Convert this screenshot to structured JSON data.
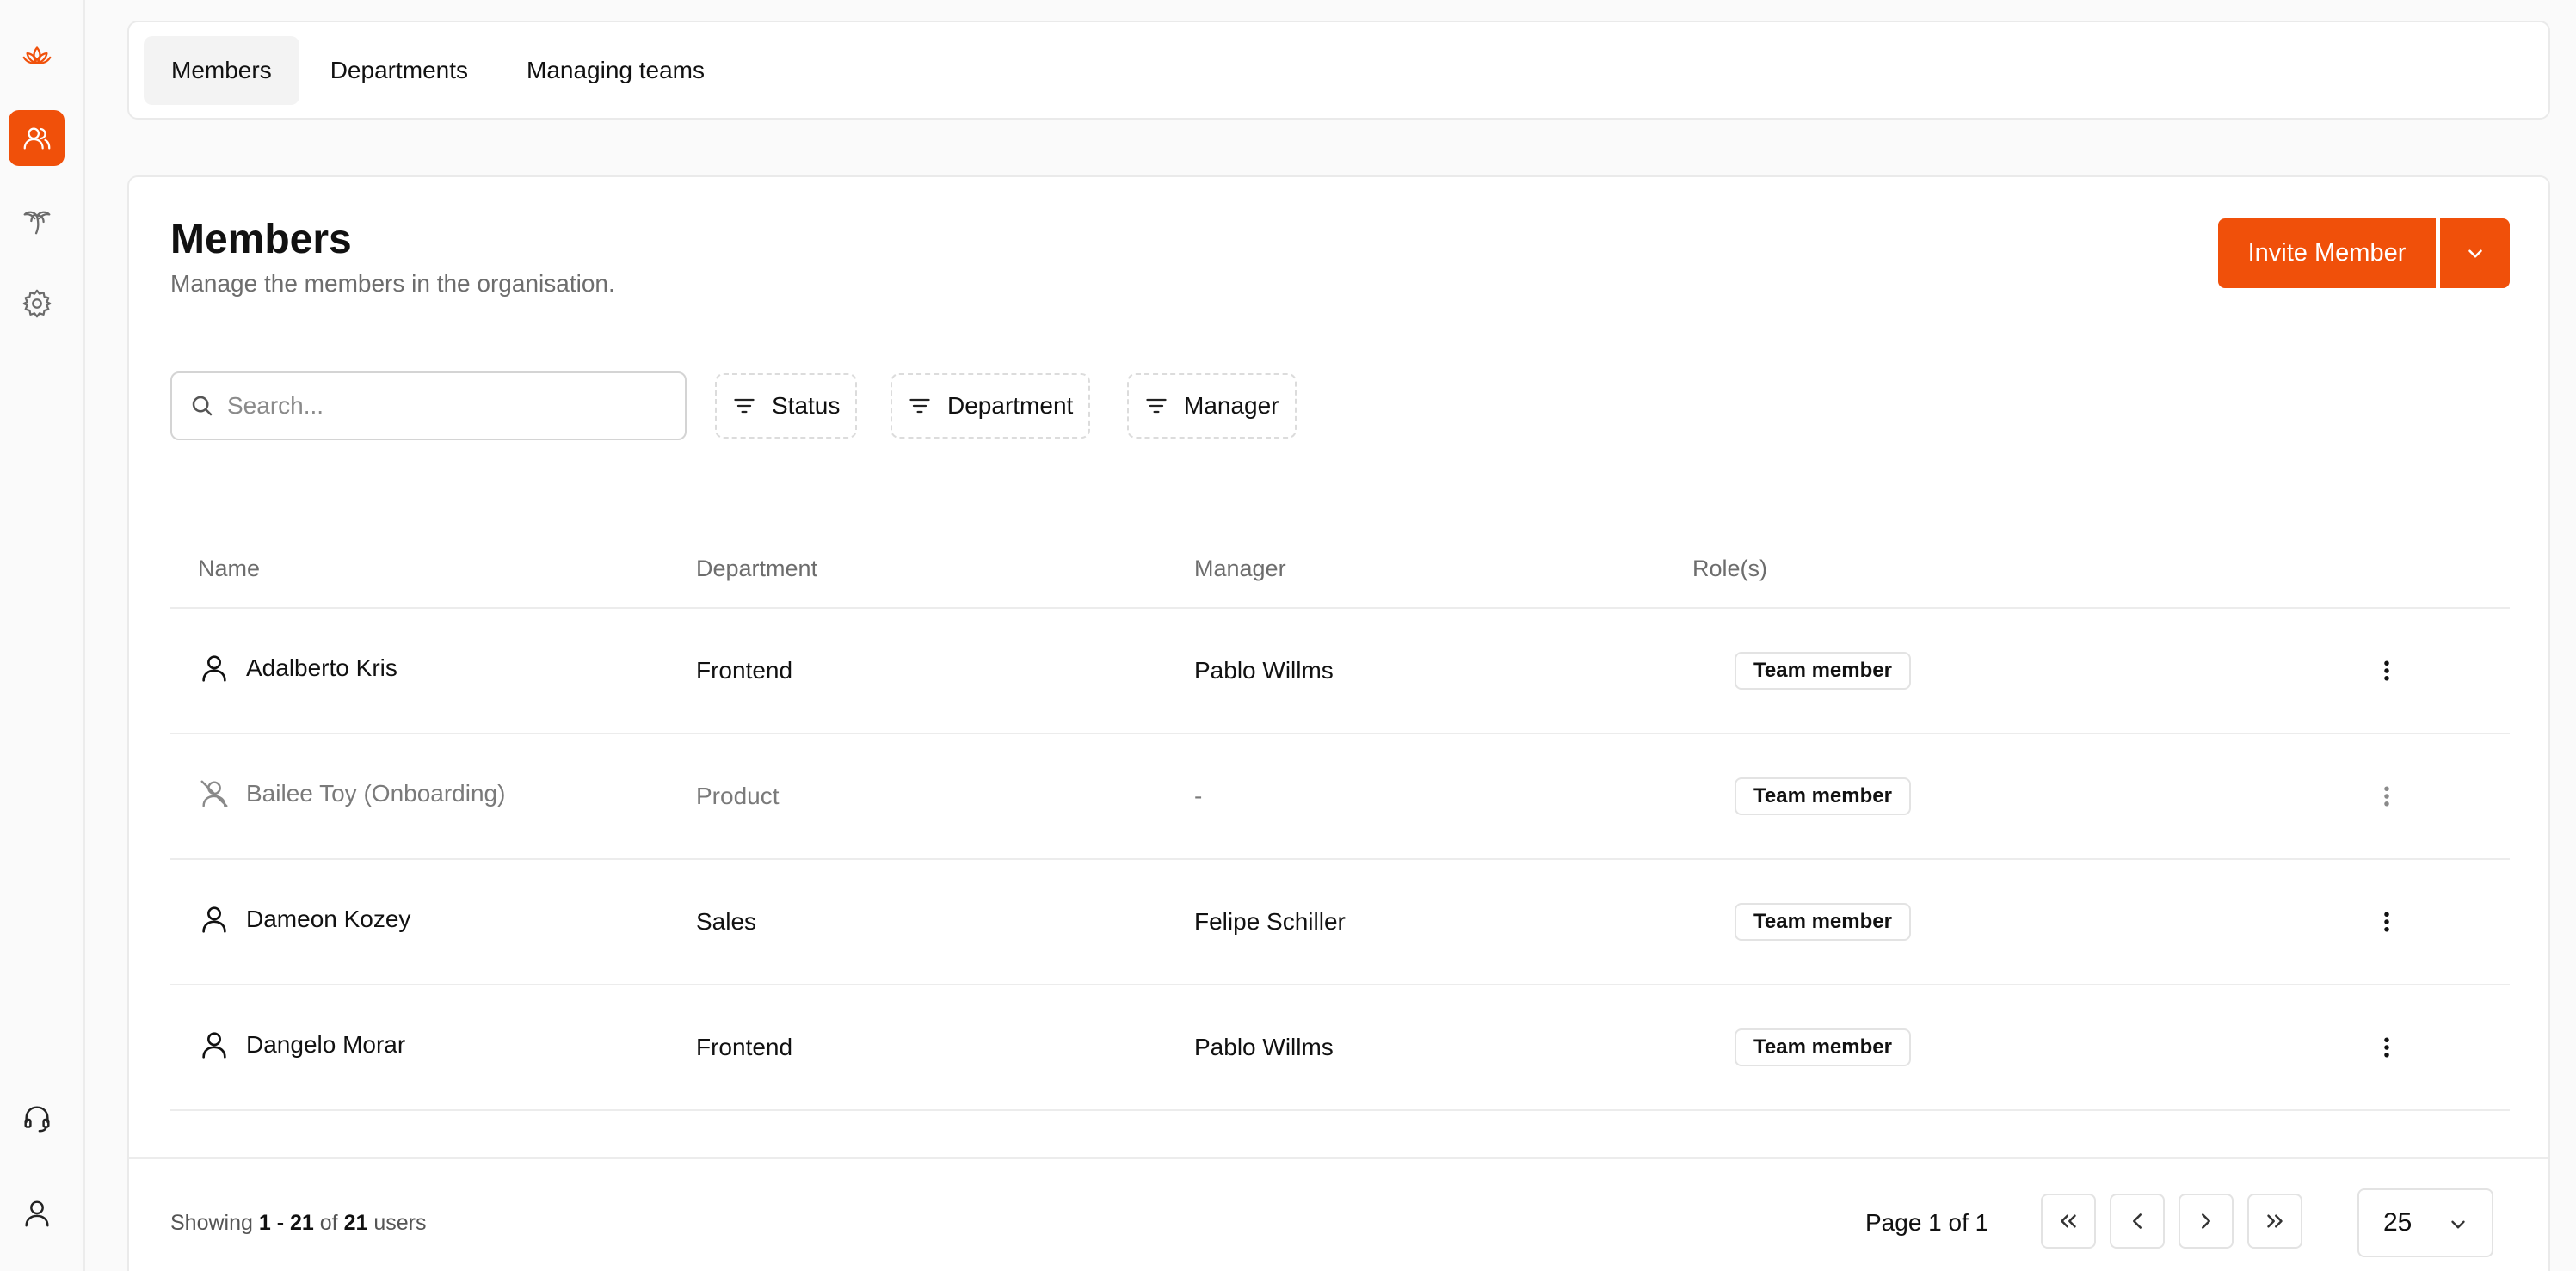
{
  "colors": {
    "accent": "#f0500a",
    "muted_text": "#6d6d6d"
  },
  "sidebar": {
    "items": [
      {
        "name": "lotus-logo-icon"
      },
      {
        "name": "members-icon",
        "active": true
      },
      {
        "name": "palm-tree-icon"
      },
      {
        "name": "settings-gear-icon"
      },
      {
        "name": "headset-support-icon"
      },
      {
        "name": "profile-user-icon"
      }
    ]
  },
  "tabs": [
    {
      "label": "Members",
      "active": true
    },
    {
      "label": "Departments"
    },
    {
      "label": "Managing teams"
    }
  ],
  "header": {
    "title": "Members",
    "subtitle": "Manage the members in the organisation.",
    "invite_label": "Invite Member"
  },
  "search": {
    "placeholder": "Search...",
    "value": ""
  },
  "filters": [
    {
      "label": "Status"
    },
    {
      "label": "Department"
    },
    {
      "label": "Manager"
    }
  ],
  "table": {
    "columns": [
      "Name",
      "Department",
      "Manager",
      "Role(s)"
    ],
    "rows": [
      {
        "name": "Adalberto Kris",
        "department": "Frontend",
        "manager": "Pablo Willms",
        "role": "Team member",
        "status": "active"
      },
      {
        "name": "Bailee Toy (Onboarding)",
        "department": "Product",
        "manager": "-",
        "role": "Team member",
        "status": "onboarding"
      },
      {
        "name": "Dameon Kozey",
        "department": "Sales",
        "manager": "Felipe Schiller",
        "role": "Team member",
        "status": "active"
      },
      {
        "name": "Dangelo Morar",
        "department": "Frontend",
        "manager": "Pablo Willms",
        "role": "Team member",
        "status": "active"
      }
    ]
  },
  "footer": {
    "showing_prefix": "Showing",
    "range": "1 - 21",
    "of": "of",
    "total": "21",
    "unit": "users",
    "page_info": "Page 1 of 1",
    "per_page": "25"
  }
}
